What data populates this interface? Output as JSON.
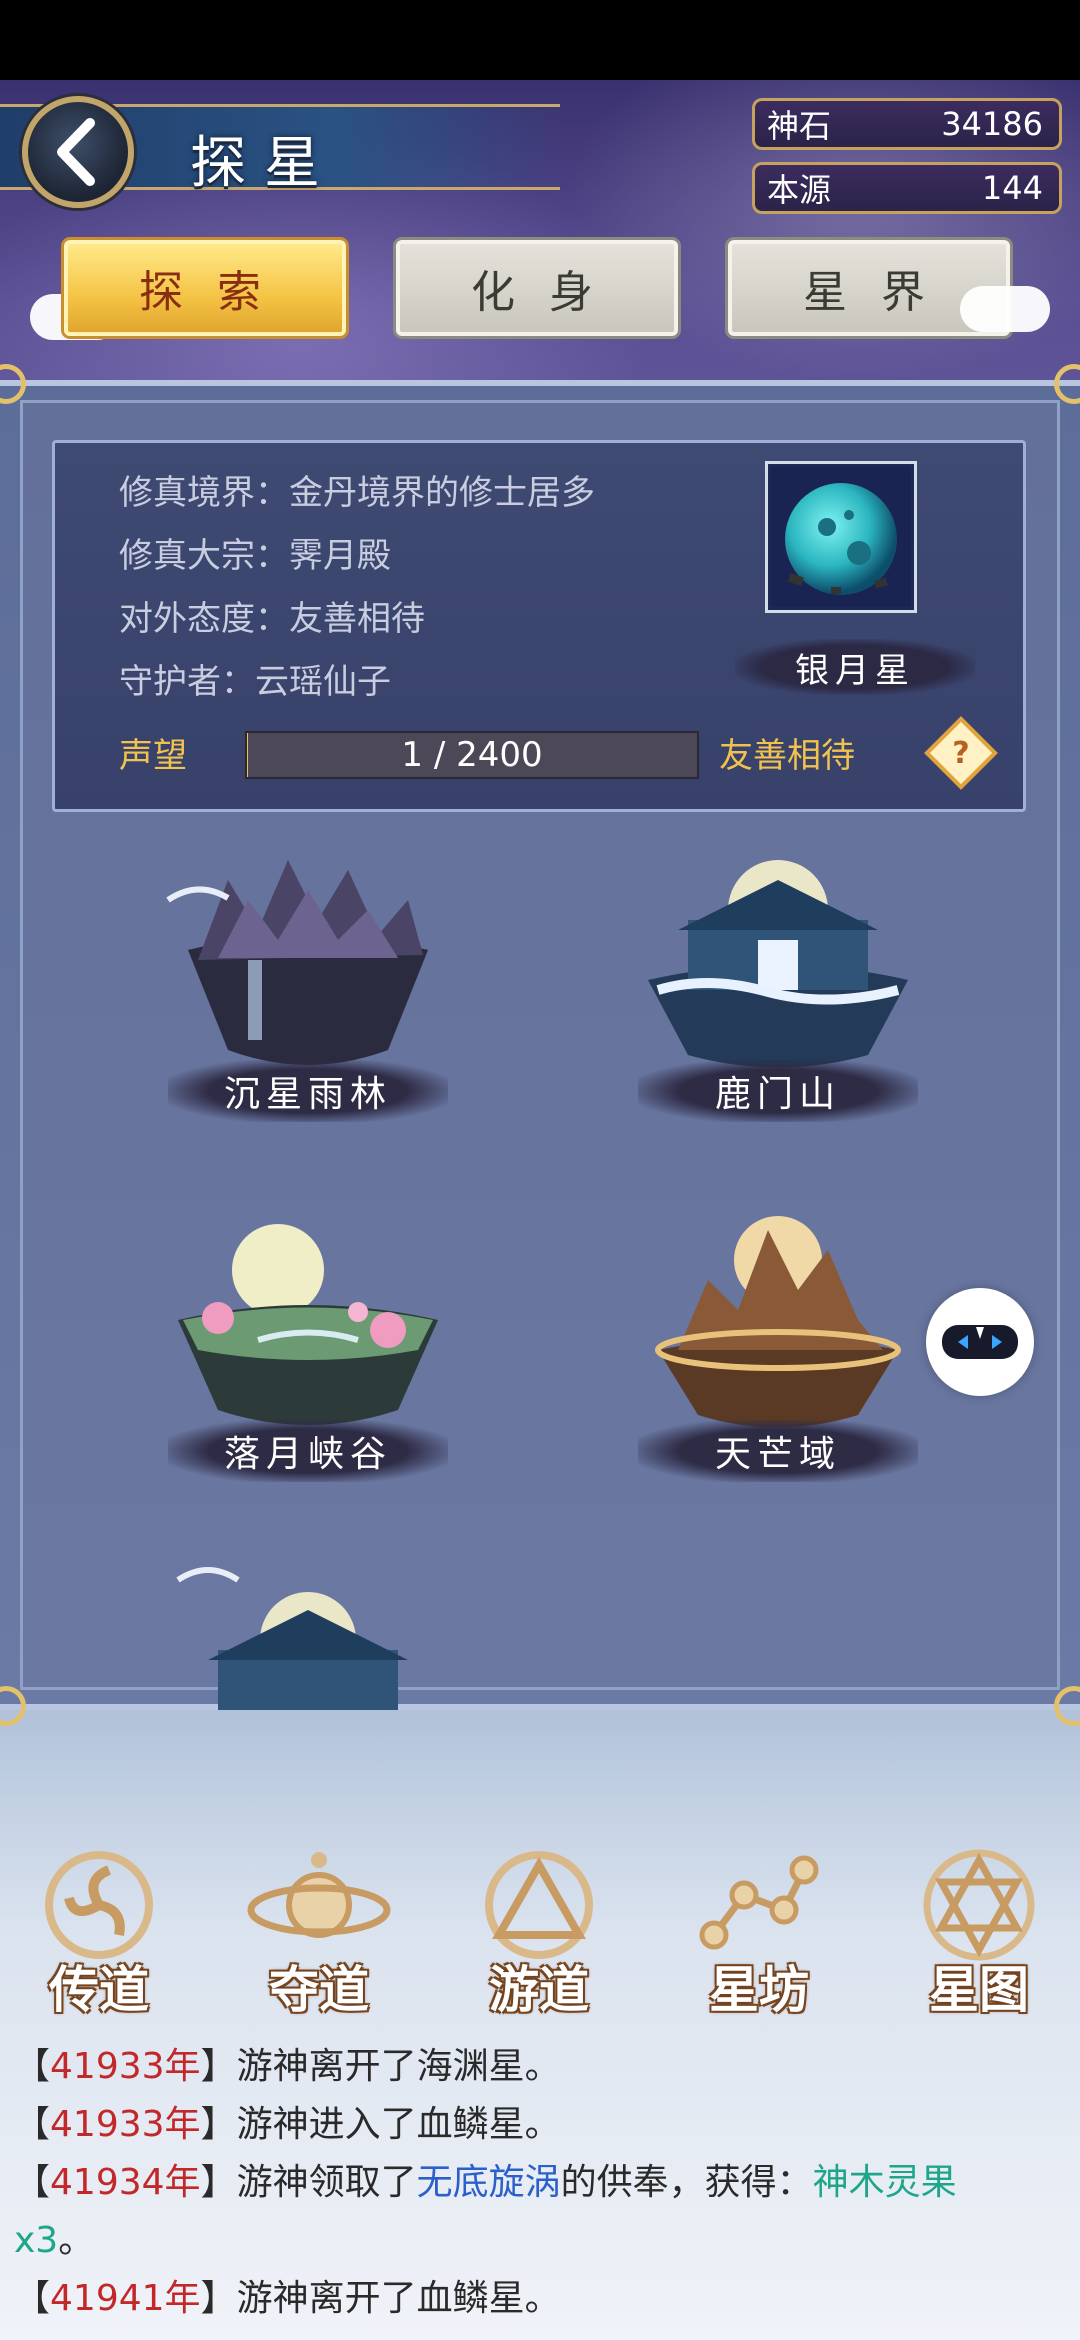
{
  "header": {
    "title": "探星",
    "currencies": [
      {
        "label": "神石",
        "value": "34186"
      },
      {
        "label": "本源",
        "value": "144"
      }
    ]
  },
  "tabs": [
    {
      "label": "探 索",
      "active": true
    },
    {
      "label": "化 身",
      "active": false
    },
    {
      "label": "星 界",
      "active": false
    }
  ],
  "planet_info": {
    "lines": [
      "修真境界：金丹境界的修士居多",
      "修真大宗：霁月殿",
      "对外态度：友善相待",
      "守护者：云瑶仙子"
    ],
    "planet_name": "银月星",
    "reputation_label": "声望",
    "reputation_value": "1 / 2400",
    "reputation_fraction": 0.0004,
    "reputation_status": "友善相待",
    "help": "?"
  },
  "locations": [
    {
      "label": "沉星雨林"
    },
    {
      "label": "鹿门山"
    },
    {
      "label": "落月峡谷"
    },
    {
      "label": "天芒域"
    }
  ],
  "bottom_nav": [
    {
      "label": "传道"
    },
    {
      "label": "夺道"
    },
    {
      "label": "游道"
    },
    {
      "label": "星坊"
    },
    {
      "label": "星图"
    }
  ],
  "log": {
    "l1_year": "41933年",
    "l1_text": "游神离开了海渊星。",
    "l2_year": "41933年",
    "l2_text": "游神进入了血鳞星。",
    "l3_year": "41934年",
    "l3_pre": "游神领取了",
    "l3_place": "无底旋涡",
    "l3_mid": "的供奉，获得：",
    "l3_item": "神木灵果",
    "l3_item2": "x3",
    "l3_end": "。",
    "l4_year": "41941年",
    "l4_text": "游神离开了血鳞星。",
    "bracket_open": "【",
    "bracket_close": "】"
  },
  "colors": {
    "year": "#c2282a",
    "place": "#2b5fc9",
    "item": "#1fa68a",
    "reputation": "#f1c24e"
  }
}
